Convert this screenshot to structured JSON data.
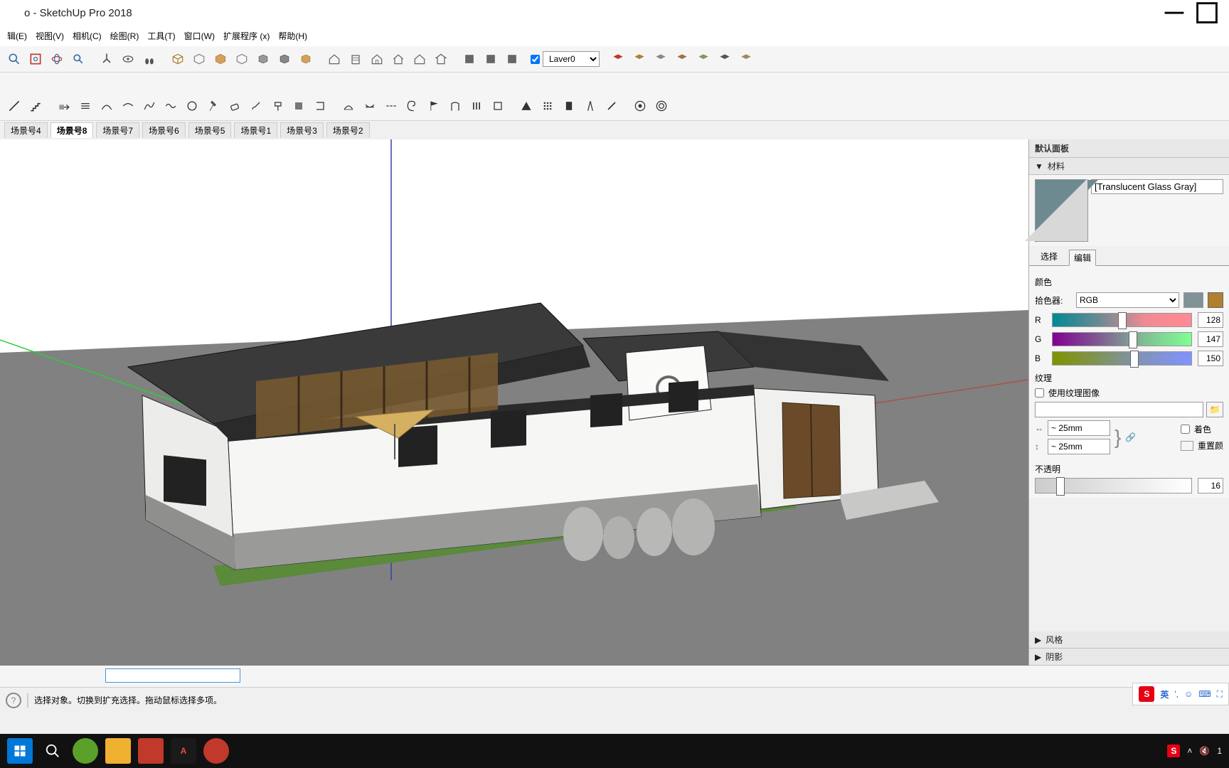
{
  "title": "o - SketchUp Pro 2018",
  "menus": [
    "辑(E)",
    "视图(V)",
    "相机(C)",
    "绘图(R)",
    "工具(T)",
    "窗口(W)",
    "扩展程序 (x)",
    "帮助(H)"
  ],
  "layer_options": [
    "Laver0"
  ],
  "layer_checked": true,
  "scenes": [
    "场景号4",
    "场景号8",
    "场景号7",
    "场景号6",
    "场景号5",
    "场景号1",
    "场景号3",
    "场景号2"
  ],
  "active_scene": 1,
  "side": {
    "default_panel": "默认面板",
    "materials": "材料",
    "material_name": "[Translucent Glass Gray]",
    "tab_select": "选择",
    "tab_edit": "编辑",
    "active_tab": "编辑",
    "color_label": "颜色",
    "picker_label": "拾色器:",
    "picker_options": [
      "RGB"
    ],
    "r_label": "R",
    "r_val": "128",
    "g_label": "G",
    "g_val": "147",
    "b_label": "B",
    "b_val": "150",
    "texture_label": "纹理",
    "use_texture": "使用纹理图像",
    "tex_w": "~ 25mm",
    "tex_h": "~ 25mm",
    "reset_label": "重置颜",
    "color_tint_label": "着色",
    "opacity_label": "不透明",
    "opacity_val": "16",
    "styles": "风格",
    "shadows": "阴影"
  },
  "status": {
    "icon": "?",
    "text": "选择对象。切换到扩充选择。拖动鼠标选择多项。"
  },
  "ime": {
    "lang": "英",
    "dots": "',",
    "icons": [
      "☺",
      "⌨",
      "⛶"
    ]
  }
}
